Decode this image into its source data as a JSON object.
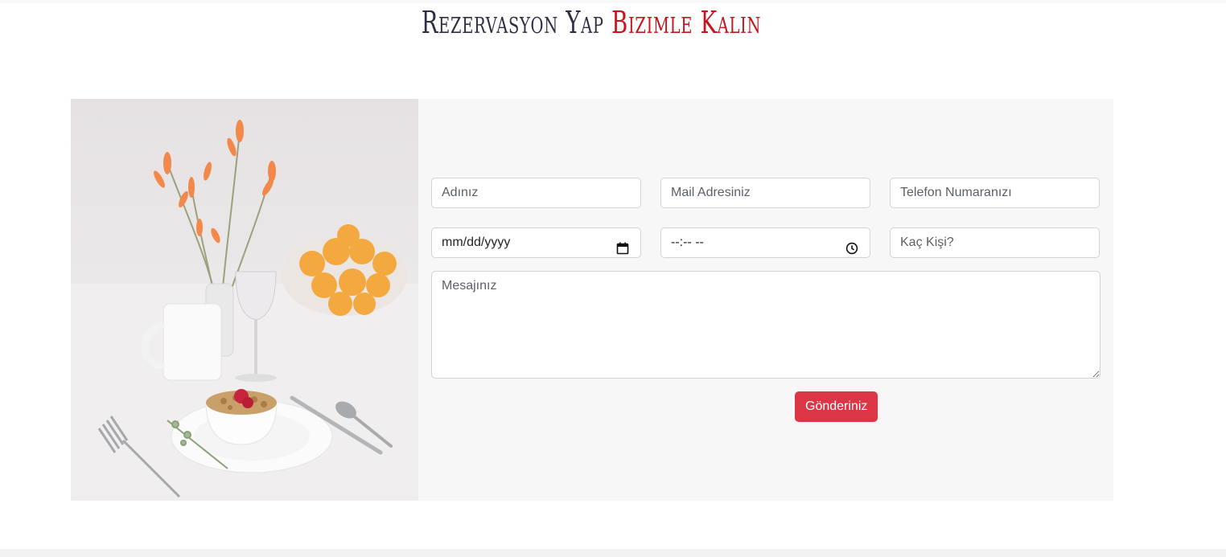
{
  "heading": {
    "part1": "Rezervasyon Yap",
    "part2": "Bizimle Kalın"
  },
  "form": {
    "name_placeholder": "Adınız",
    "email_placeholder": "Mail Adresiniz",
    "phone_placeholder": "Telefon Numaranızı",
    "date_placeholder": "mm/dd/yyyy",
    "time_placeholder": "--:-- --",
    "people_placeholder": "Kaç Kişi?",
    "message_placeholder": "Mesajınız",
    "submit_label": "Gönderiniz"
  },
  "colors": {
    "accent": "#dc3545",
    "heading_dark": "#2e2f45",
    "heading_red": "#c8151c",
    "panel_bg": "#f7f7f7"
  },
  "icons": {
    "date": "calendar-icon",
    "time": "clock-icon"
  }
}
